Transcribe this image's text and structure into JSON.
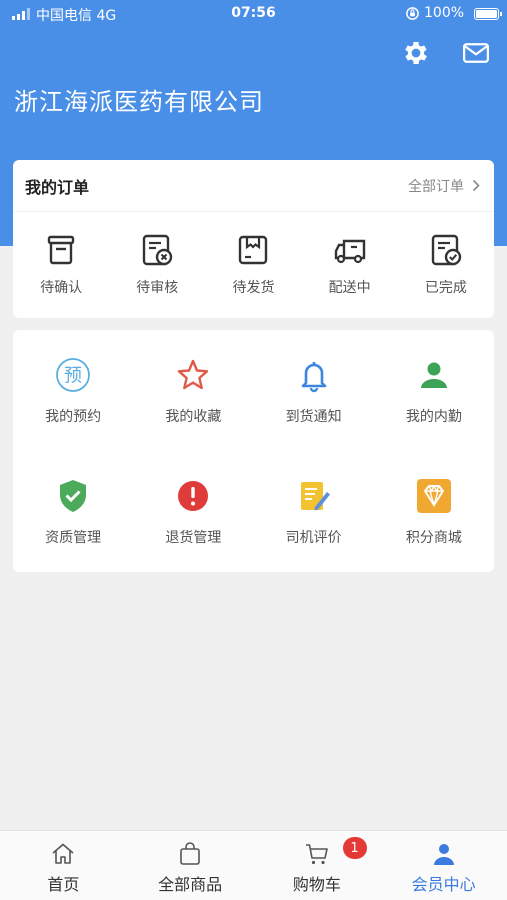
{
  "status_bar": {
    "carrier": "中国电信  4G",
    "time": "07:56",
    "battery": "100%"
  },
  "header": {
    "company_name": "浙江海派医药有限公司",
    "icons": [
      "gear-icon",
      "mail-icon"
    ]
  },
  "orders": {
    "title": "我的订单",
    "all_link": "全部订单",
    "items": [
      {
        "label": "待确认",
        "icon": "box-icon"
      },
      {
        "label": "待审核",
        "icon": "review-icon"
      },
      {
        "label": "待发货",
        "icon": "package-icon"
      },
      {
        "label": "配送中",
        "icon": "truck-icon"
      },
      {
        "label": "已完成",
        "icon": "done-icon"
      }
    ]
  },
  "services": {
    "items": [
      {
        "label": "我的预约",
        "icon": "reserve-icon",
        "color": "#5aaedf",
        "glyph": "预"
      },
      {
        "label": "我的收藏",
        "icon": "star-icon",
        "color": "#e05a47"
      },
      {
        "label": "到货通知",
        "icon": "bell-icon",
        "color": "#3d86e0"
      },
      {
        "label": "我的内勤",
        "icon": "person-icon",
        "color": "#3da357"
      },
      {
        "label": "资质管理",
        "icon": "shield-check-icon",
        "color": "#4cab5a"
      },
      {
        "label": "退货管理",
        "icon": "alert-icon",
        "color": "#e03b3b"
      },
      {
        "label": "司机评价",
        "icon": "note-pen-icon",
        "color": "#f2c230"
      },
      {
        "label": "积分商城",
        "icon": "diamond-icon",
        "color": "#f0a830"
      }
    ]
  },
  "tab_bar": {
    "tabs": [
      {
        "label": "首页",
        "icon": "home-icon"
      },
      {
        "label": "全部商品",
        "icon": "bag-icon"
      },
      {
        "label": "购物车",
        "icon": "cart-icon",
        "badge": "1"
      },
      {
        "label": "会员中心",
        "icon": "user-icon",
        "active": true
      }
    ]
  },
  "colors": {
    "brand": "#4a8fe7",
    "active_tab": "#3b7be0",
    "badge": "#e53935"
  }
}
